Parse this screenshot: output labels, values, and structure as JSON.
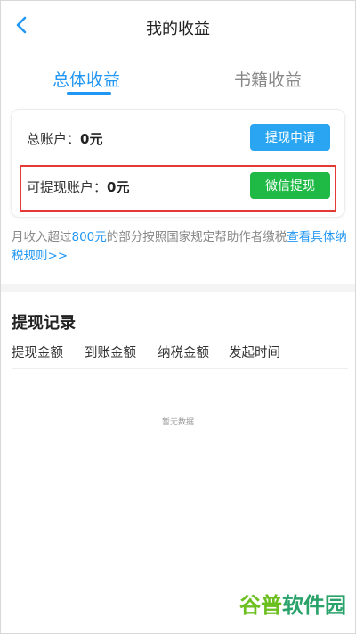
{
  "header": {
    "title": "我的收益",
    "back_icon": "chevron-left-icon"
  },
  "tabs": [
    {
      "label": "总体收益",
      "active": true
    },
    {
      "label": "书籍收益",
      "active": false
    }
  ],
  "account": {
    "total_label": "总账户：",
    "total_value": "0元",
    "apply_button": "提现申请",
    "withdrawable_label": "可提现账户：",
    "withdrawable_value": "0元",
    "wechat_button": "微信提现"
  },
  "note": {
    "prefix": "月收入超过",
    "amount": "800元",
    "middle": "的部分按照国家规定帮助作者缴税",
    "link": "查看具体纳税规则>>"
  },
  "records": {
    "title": "提现记录",
    "columns": [
      "提现金额",
      "到账金额",
      "纳税金额",
      "发起时间"
    ],
    "empty_text": "暂无数据"
  },
  "watermark": {
    "part1": "谷普",
    "part2": "软件园"
  },
  "colors": {
    "accent": "#2196f3",
    "button_blue": "#29a5f2",
    "button_green": "#1fba45",
    "highlight": "#e53935"
  }
}
